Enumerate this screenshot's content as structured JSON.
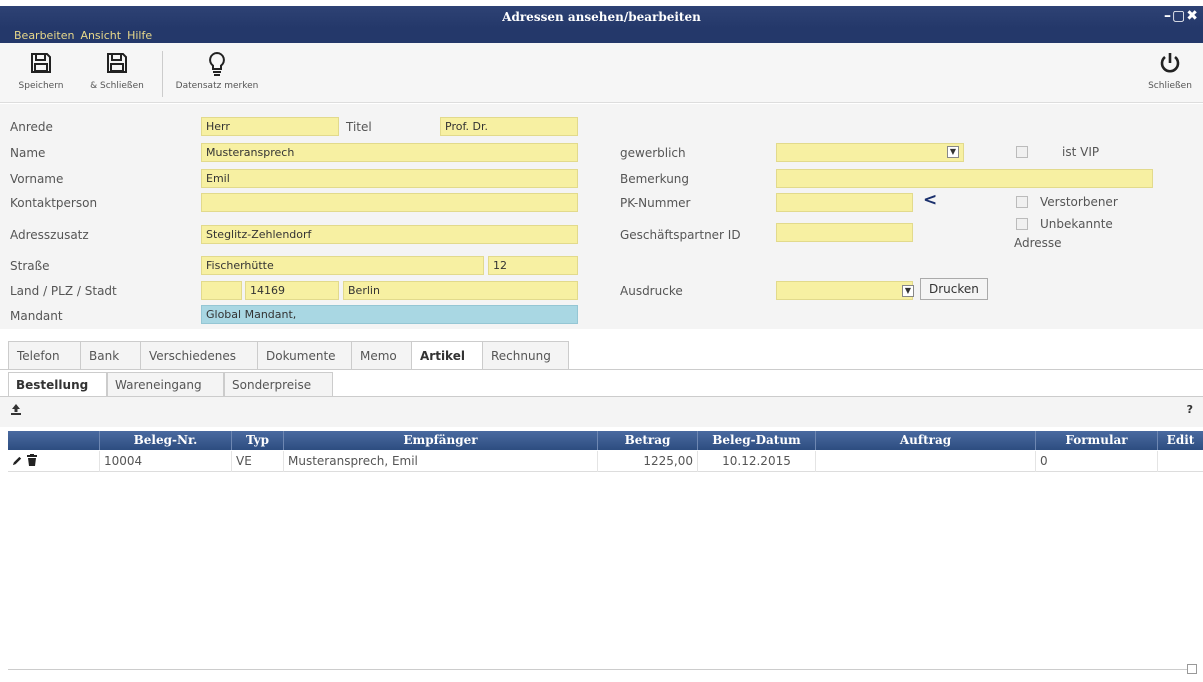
{
  "window": {
    "title": "Adressen ansehen/bearbeiten",
    "controls": "–▢✖"
  },
  "menu": [
    "Bearbeiten",
    "Ansicht",
    "Hilfe"
  ],
  "toolbar": {
    "save": "Speichern",
    "save_close": "& Schließen",
    "remember": "Datensatz merken",
    "close": "Schließen"
  },
  "form": {
    "anrede_label": "Anrede",
    "anrede": "Herr",
    "titel_label": "Titel",
    "titel": "Prof. Dr.",
    "name_label": "Name",
    "name": "Musteransprech",
    "vorname_label": "Vorname",
    "vorname": "Emil",
    "kontakt_label": "Kontaktperson",
    "kontakt": "",
    "zusatz_label": "Adresszusatz",
    "zusatz": "Steglitz-Zehlendorf",
    "strasse_label": "Straße",
    "strasse": "Fischerhütte",
    "hausnr": "12",
    "land_label": "Land / PLZ / Stadt",
    "land": "",
    "plz": "14169",
    "stadt": "Berlin",
    "mandant_label": "Mandant",
    "mandant": "Global Mandant,",
    "gewerblich_label": "gewerblich",
    "gewerblich": "",
    "vip_label": "ist VIP",
    "bemerkung_label": "Bemerkung",
    "bemerkung": "",
    "pk_label": "PK-Nummer",
    "pk": "",
    "verstorben_label": "Verstorbener",
    "gp_label": "Geschäftspartner ID",
    "gp": "",
    "unbekannt_label1": "Unbekannte",
    "unbekannt_label2": "Adresse",
    "ausdrucke_label": "Ausdrucke",
    "ausdrucke": "",
    "drucken": "Drucken"
  },
  "tabs": [
    "Telefon",
    "Bank",
    "Verschiedenes",
    "Dokumente",
    "Memo",
    "Artikel",
    "Rechnung"
  ],
  "subtabs": [
    "Bestellung",
    "Wareneingang",
    "Sonderpreise"
  ],
  "grid": {
    "help": "?",
    "columns": [
      "",
      "Beleg-Nr.",
      "Typ",
      "Empfänger",
      "Betrag",
      "Beleg-Datum",
      "Auftrag",
      "Formular",
      "Edit"
    ],
    "rows": [
      {
        "beleg": "10004",
        "typ": "VE",
        "empfaenger": "Musteransprech, Emil",
        "betrag": "1225,00",
        "datum": "10.12.2015",
        "auftrag": "",
        "formular": "0",
        "edit": ""
      }
    ]
  },
  "colors": {
    "title_bg": "#24386a",
    "field_yellow": "#f7f0a2",
    "field_blue": "#a9d7e3",
    "grid_header": "#3b5b8f"
  }
}
